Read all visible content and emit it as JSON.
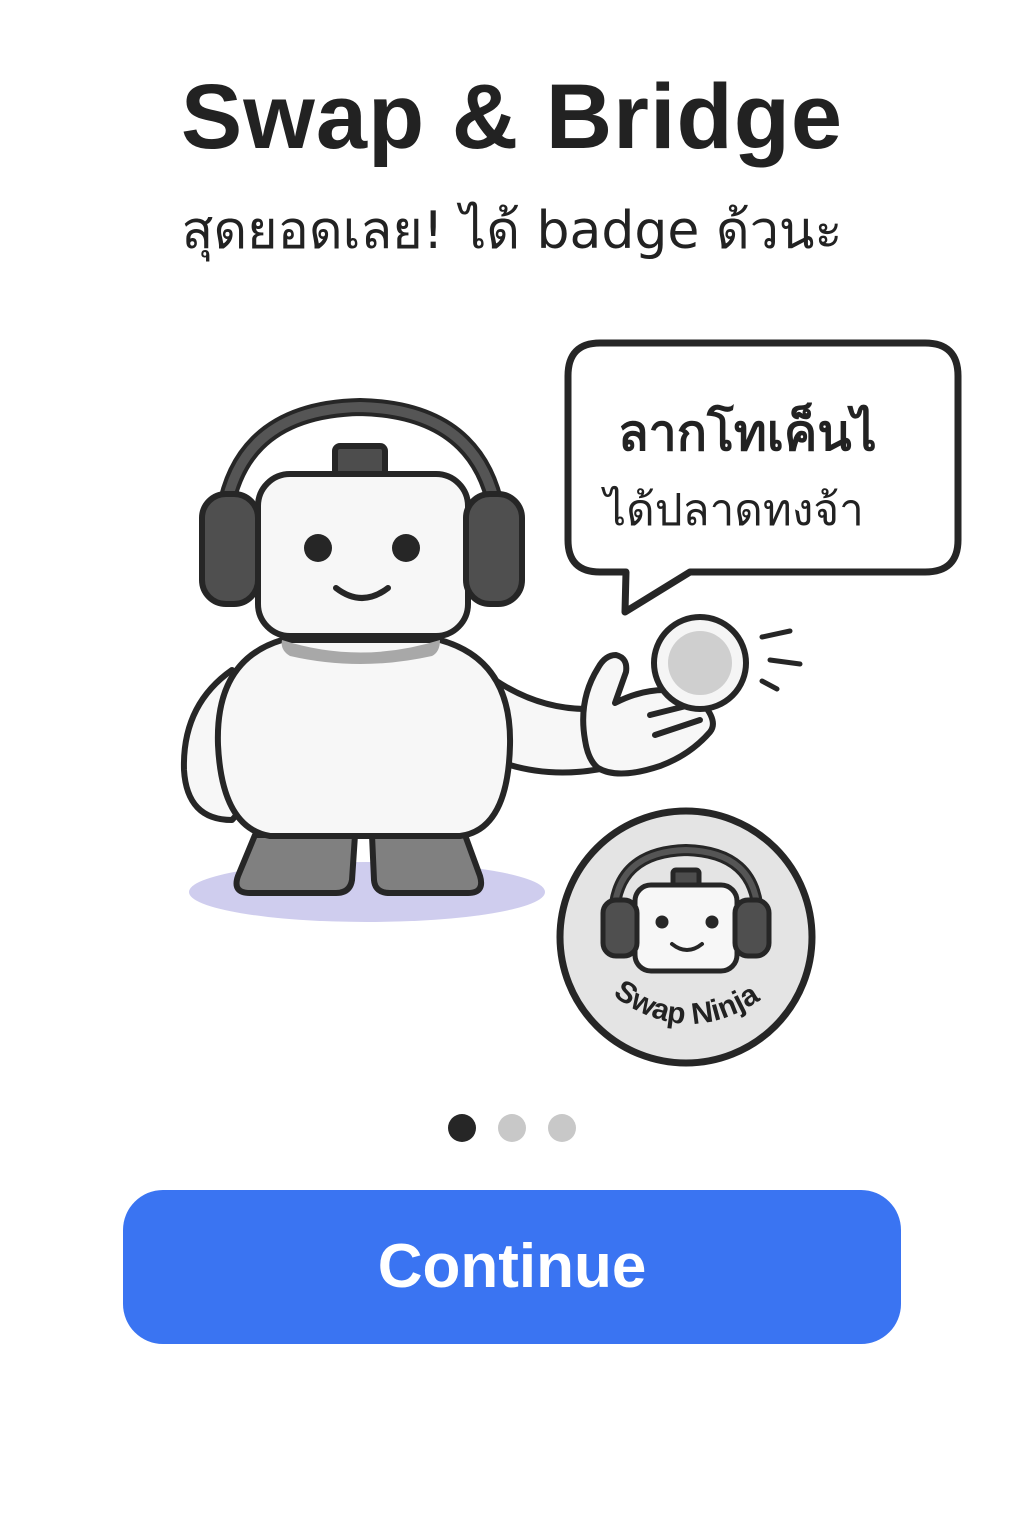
{
  "header": {
    "title": "Swap & Bridge",
    "subtitle": "สุดยอดเลย! ได้ badge ด้วนะ"
  },
  "speech_bubble": {
    "line1": "ลากโทเค็นไ",
    "line2": "ได้ปลาดทงจ้า"
  },
  "badge": {
    "label": "Swap Ninja"
  },
  "pagination": {
    "total": 3,
    "active_index": 0
  },
  "cta": {
    "label": "Continue"
  },
  "colors": {
    "primary": "#3a74f2",
    "dot_active": "#262626",
    "dot_inactive": "#c8c8c8",
    "shadow": "#cfcdee"
  }
}
